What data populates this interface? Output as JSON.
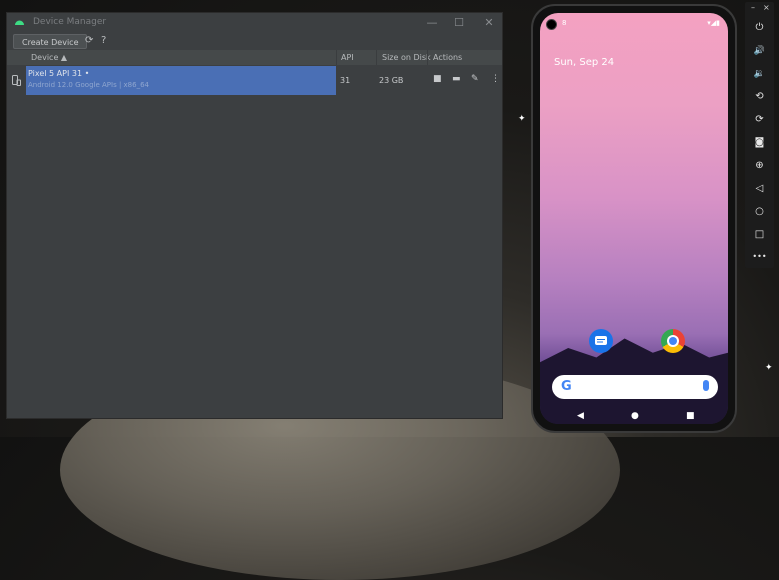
{
  "window": {
    "title": "Device Manager",
    "minimize": "—",
    "maximize": "☐",
    "close": "✕"
  },
  "toolbar": {
    "create_label": "Create Device",
    "refresh_icon": "refresh-icon",
    "help_label": "?"
  },
  "table": {
    "columns": [
      "Device ▲",
      "API",
      "Size on Disk",
      "Actions"
    ],
    "rows": [
      {
        "name": "Pixel 5 API 31",
        "running_indicator": "•",
        "subtitle": "Android 12.0 Google APIs | x86_64",
        "api": "31",
        "size": "23 GB"
      }
    ]
  },
  "phone": {
    "status_left": "8",
    "status_right": "▾◢▮",
    "date": "Sun, Sep 24",
    "search_logo": "G",
    "nav_back": "◀",
    "nav_home": "●",
    "nav_recents": "■",
    "apps": [
      "messages-icon",
      "chrome-icon"
    ]
  },
  "emulator_toolbar": {
    "minimize": "–",
    "close": "×",
    "buttons": [
      "⏻",
      "🔊",
      "🔉",
      "⟲",
      "⟳",
      "◙",
      "⊕",
      "◁",
      "○",
      "□",
      "•••"
    ]
  },
  "colors": {
    "selection": "#4a6fb5",
    "window_bg": "#3c3f41",
    "android_green": "#3ddc84"
  }
}
